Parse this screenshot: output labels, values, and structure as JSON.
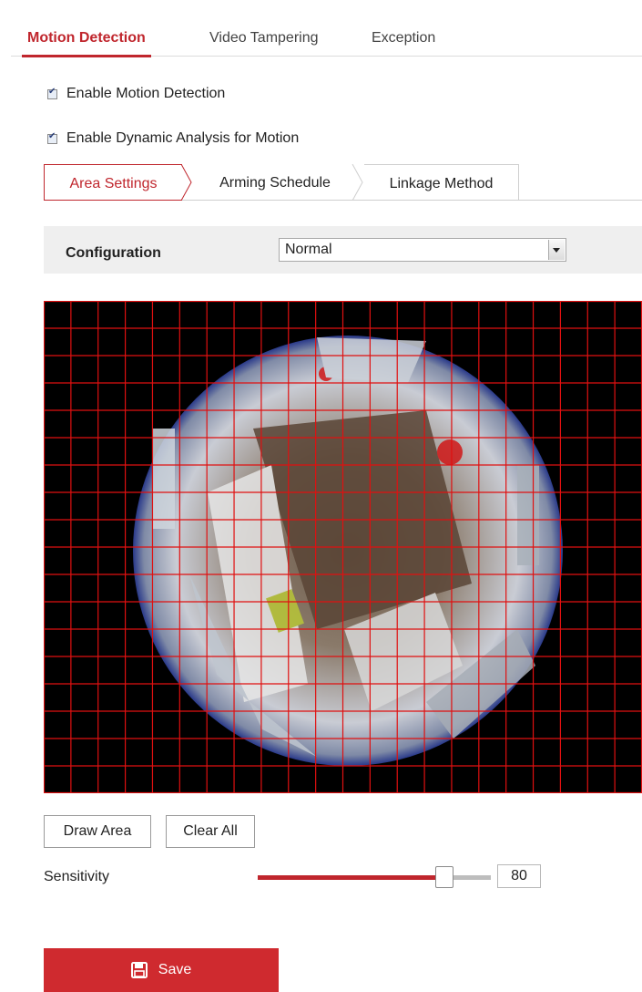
{
  "top_tabs": [
    {
      "label": "Motion Detection",
      "active": true
    },
    {
      "label": "Video Tampering",
      "active": false
    },
    {
      "label": "Exception",
      "active": false
    }
  ],
  "checkboxes": {
    "enable_motion": {
      "label": "Enable Motion Detection",
      "checked": true
    },
    "enable_dynamic": {
      "label": "Enable Dynamic Analysis for Motion",
      "checked": true
    }
  },
  "sub_tabs": [
    {
      "label": "Area Settings",
      "active": true
    },
    {
      "label": "Arming Schedule",
      "active": false
    },
    {
      "label": "Linkage Method",
      "active": false
    }
  ],
  "configuration": {
    "label": "Configuration",
    "value": "Normal"
  },
  "buttons": {
    "draw_area": "Draw Area",
    "clear_all": "Clear All",
    "save": "Save"
  },
  "sensitivity": {
    "label": "Sensitivity",
    "value": "80",
    "fraction": 0.8
  },
  "colors": {
    "accent": "#c0262d",
    "grid": "#e01010",
    "save_bg": "#cf2a2f"
  },
  "icons": {
    "save": "floppy-disk-icon",
    "dropdown": "chevron-down-icon"
  }
}
